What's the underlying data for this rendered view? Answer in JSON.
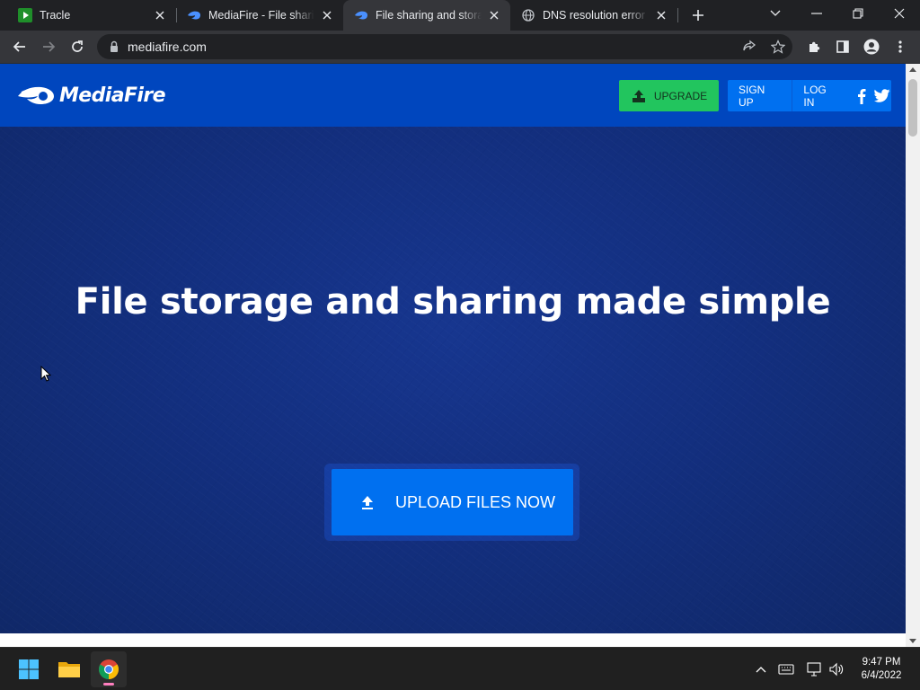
{
  "browser": {
    "tabs": [
      {
        "title": "Tracle",
        "favicon": "tracle-play-icon",
        "active": false
      },
      {
        "title": "MediaFire - File sharing and storage",
        "favicon": "mediafire-flame-icon",
        "active": false
      },
      {
        "title": "File sharing and storage made simple",
        "favicon": "mediafire-flame-icon",
        "active": true
      },
      {
        "title": "DNS resolution error | MediaFire",
        "favicon": "globe-icon",
        "active": false
      }
    ],
    "url": "mediafire.com"
  },
  "page": {
    "logo_text": "MediaFire",
    "upgrade_label": "UPGRADE",
    "signup_label": "SIGN UP",
    "login_label": "LOG IN",
    "hero_title": "File storage and sharing made simple",
    "upload_label": "UPLOAD FILES NOW"
  },
  "taskbar": {
    "time": "9:47 PM",
    "date": "6/4/2022"
  },
  "colors": {
    "header": "#0046be",
    "hero": "#132f7f",
    "primary_button": "#0070f0",
    "upgrade_button": "#22c55e"
  }
}
